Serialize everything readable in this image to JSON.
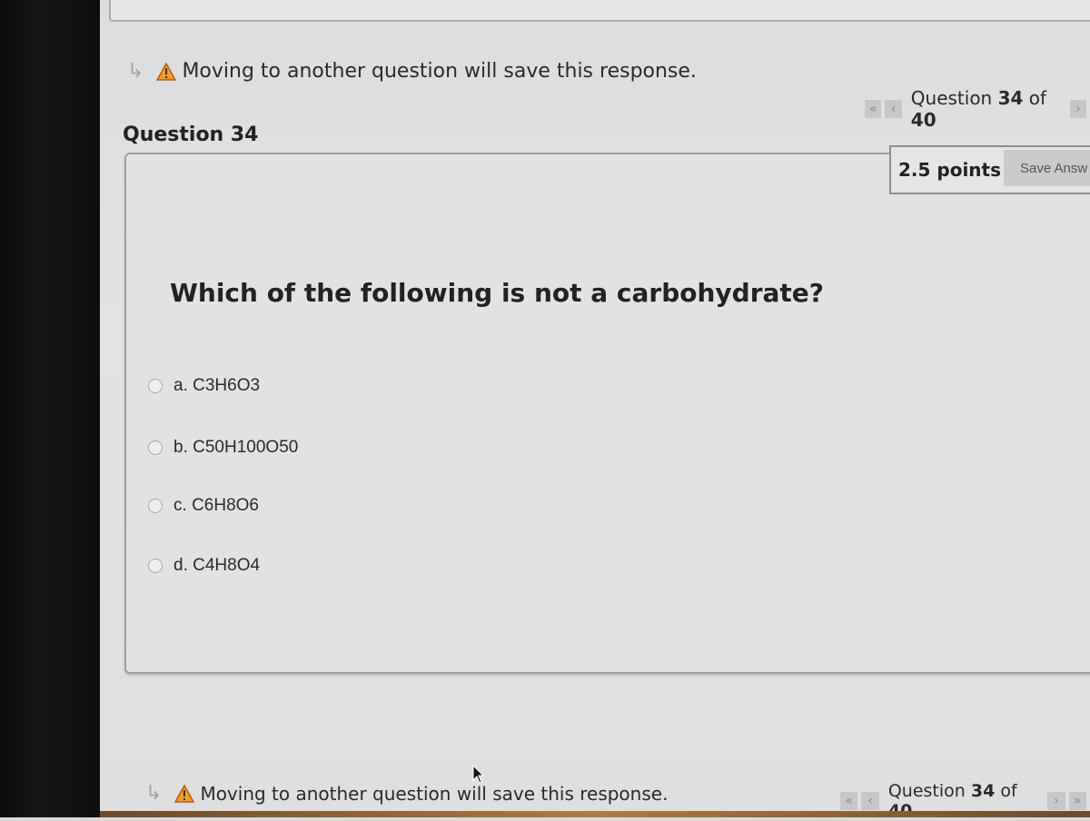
{
  "warning": {
    "text": "Moving to another question will save this response."
  },
  "question": {
    "heading": "Question 34",
    "points": "2.5 points",
    "save_label": "Save Answ",
    "prompt": "Which of the following is not a carbohydrate?",
    "choices": [
      {
        "letter": "a.",
        "label": "C3H6O3"
      },
      {
        "letter": "b.",
        "label": "C50H100O50"
      },
      {
        "letter": "c.",
        "label": "C6H8O6"
      },
      {
        "letter": "d.",
        "label": "C4H8O4"
      }
    ]
  },
  "navigation": {
    "first_icon": "«",
    "prev_icon": "‹",
    "next_icon": "›",
    "last_icon": "»",
    "label": "Question",
    "current": "34",
    "of": "of",
    "total": "40"
  },
  "colors": {
    "warning_icon": "#f0a020",
    "button_bg": "#c9cacb"
  }
}
